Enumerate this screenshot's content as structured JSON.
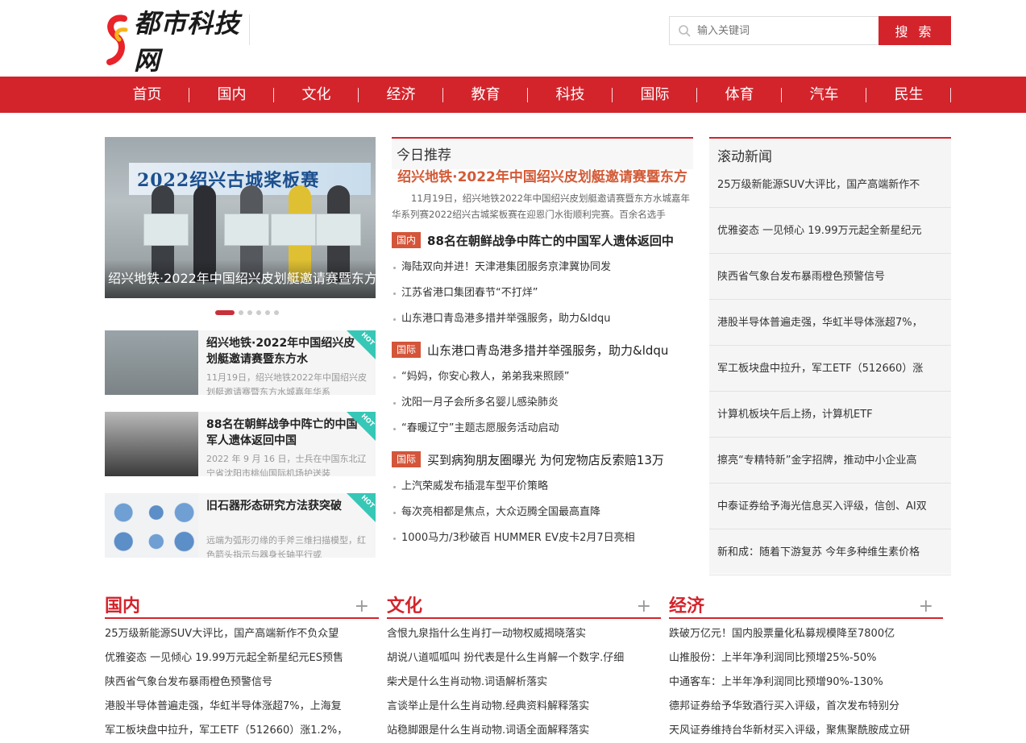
{
  "header": {
    "logo_text": "都市科技网",
    "search_placeholder": "输入关键词",
    "search_button": "搜 索"
  },
  "nav": [
    "首页",
    "国内",
    "文化",
    "经济",
    "教育",
    "科技",
    "国际",
    "体育",
    "汽车",
    "民生"
  ],
  "slider": {
    "banner_text": "2022绍兴古城桨板赛",
    "caption": "绍兴地铁·2022年中国绍兴皮划艇邀请赛暨东方",
    "dot_count": 6,
    "active_dot": 0
  },
  "features": [
    {
      "title": "绍兴地铁·2022年中国绍兴皮划艇邀请赛暨东方水",
      "desc": "11月19日，绍兴地铁2022年中国绍兴皮划艇邀请赛暨东方水城嘉年华系",
      "badge": "HOT"
    },
    {
      "title": "88名在朝鲜战争中阵亡的中国军人遗体返回中国",
      "desc": "2022 年 9 月 16 日，士兵在中国东北辽宁省沈阳市桃仙国际机场护送装",
      "badge": "HOT"
    },
    {
      "title": "旧石器形态研究方法获突破",
      "desc": "远端为弧形刃缘的手斧三维扫描模型，红色箭头指示与器身长轴平行或",
      "badge": "HOT"
    }
  ],
  "today": {
    "heading": "今日推荐",
    "headline": "绍兴地铁·2022年中国绍兴皮划艇邀请赛暨东方",
    "summary": "11月19日，绍兴地铁2022年中国绍兴皮划艇邀请赛暨东方水城嘉年华系列赛2022绍兴古城桨板赛在迎恩门水街顺利完赛。百余名选手",
    "groups": [
      {
        "tag": "国内",
        "title": "88名在朝鲜战争中阵亡的中国军人遗体返回中",
        "bold": true,
        "items": [
          "海陆双向并进！天津港集团服务京津冀协同发",
          "江苏省港口集团春节“不打烊”",
          "山东港口青岛港多措并举强服务，助力&ldqu"
        ]
      },
      {
        "tag": "国际",
        "title": "山东港口青岛港多措并举强服务，助力&ldqu",
        "bold": false,
        "items": [
          "“妈妈，你安心救人，弟弟我来照顾”",
          "沈阳一月子会所多名婴儿感染肺炎",
          "“春暖辽宁”主题志愿服务活动启动"
        ]
      },
      {
        "tag": "国际",
        "title": "买到病狗朋友圈曝光 为何宠物店反索赔13万",
        "bold": false,
        "items": [
          "上汽荣威发布插混车型平价策略",
          "每次亮相都是焦点，大众迈腾全国最高直降",
          "1000马力/3秒破百 HUMMER EV皮卡2月7日亮相"
        ]
      }
    ]
  },
  "rolling": {
    "heading": "滚动新闻",
    "items": [
      "25万级新能源SUV大评比，国产高端新作不",
      "优雅姿态 一见倾心 19.99万元起全新星纪元",
      "陕西省气象台发布暴雨橙色预警信号",
      "港股半导体普遍走强，华虹半导体涨超7%，",
      "军工板块盘中拉升，军工ETF（512660）涨",
      "计算机板块午后上扬，计算机ETF",
      "擦亮“专精特新”金字招牌，推动中小企业高",
      "中泰证券给予海光信息买入评级，信创、AI双",
      "新和成：随着下游复苏 今年多种维生素价格"
    ]
  },
  "sections": [
    {
      "title": "国内",
      "plus": "+",
      "items": [
        "25万级新能源SUV大评比，国产高端新作不负众望",
        "优雅姿态 一见倾心 19.99万元起全新星纪元ES预售",
        "陕西省气象台发布暴雨橙色预警信号",
        "港股半导体普遍走强，华虹半导体涨超7%，上海复",
        "军工板块盘中拉升，军工ETF（512660）涨1.2%，"
      ]
    },
    {
      "title": "文化",
      "plus": "+",
      "items": [
        "含恨九泉指什么生肖打一动物权威揭晓落实",
        "胡说八道呱呱叫 扮代表是什么生肖解一个数字.仔细",
        "柴犬是什么生肖动物.词语解析落实",
        "言谈举止是什么生肖动物.经典资料解释落实",
        "站稳脚跟是什么生肖动物.词语全面解释落实"
      ]
    },
    {
      "title": "经济",
      "plus": "+",
      "items": [
        "跌破万亿元！国内股票量化私募规模降至7800亿",
        "山推股份：上半年净利润同比预增25%-50%",
        "中通客车：上半年净利润同比预增90%-130%",
        "德邦证券给予华致酒行买入评级，首次发布特别分",
        "天风证券维持台华新材买入评级，聚焦聚酰胺成立研"
      ]
    }
  ]
}
